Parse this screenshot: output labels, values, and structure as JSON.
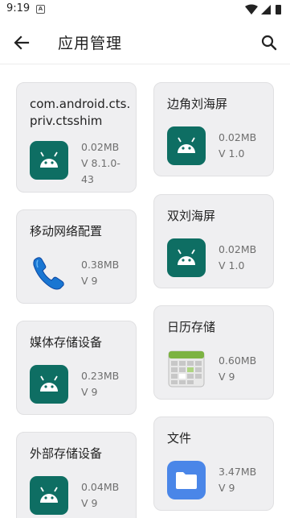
{
  "status_bar": {
    "time": "9:19",
    "notification_letter": "A"
  },
  "app_bar": {
    "title": "应用管理"
  },
  "apps": [
    {
      "name": "com.android.cts.priv.ctsshim",
      "size": "0.02MB",
      "version": "V 8.1.0-43",
      "icon": "android-icon"
    },
    {
      "name": "边角刘海屏",
      "size": "0.02MB",
      "version": "V 1.0",
      "icon": "android-icon"
    },
    {
      "name": "移动网络配置",
      "size": "0.38MB",
      "version": "V 9",
      "icon": "phone-icon"
    },
    {
      "name": "双刘海屏",
      "size": "0.02MB",
      "version": "V 1.0",
      "icon": "android-icon"
    },
    {
      "name": "媒体存储设备",
      "size": "0.23MB",
      "version": "V 9",
      "icon": "android-icon"
    },
    {
      "name": "日历存储",
      "size": "0.60MB",
      "version": "V 9",
      "icon": "calendar-icon"
    },
    {
      "name": "外部存储设备",
      "size": "0.04MB",
      "version": "V 9",
      "icon": "android-icon"
    },
    {
      "name": "文件",
      "size": "3.47MB",
      "version": "V 9",
      "icon": "files-icon"
    }
  ],
  "colors": {
    "android_tile": "#0e6e63",
    "card_bg": "#efeff1",
    "files_blue": "#4a86e8"
  }
}
